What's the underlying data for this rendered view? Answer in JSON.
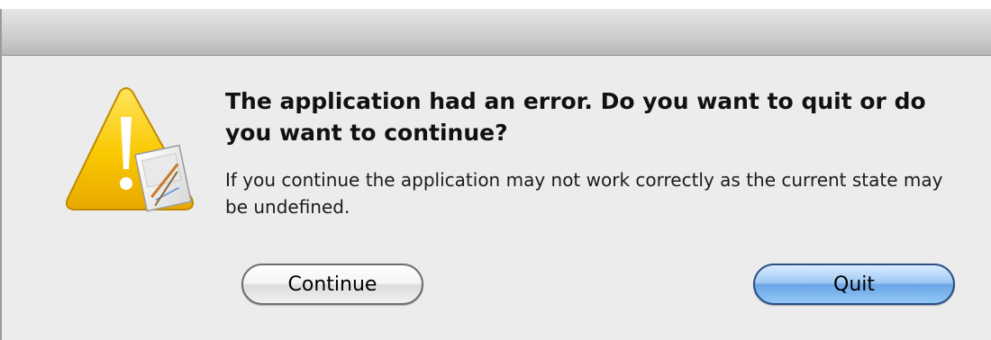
{
  "dialog": {
    "title": "The application had an error. Do you want to quit or do you want to continue?",
    "message": "If you continue the application may not work correctly as the current state may be undefined.",
    "icon": "caution-warning-icon",
    "buttons": {
      "continue_label": "Continue",
      "quit_label": "Quit"
    }
  },
  "colors": {
    "warning_yellow": "#f7c400",
    "default_button_blue": "#6aa6e6",
    "window_background": "#ececec"
  }
}
